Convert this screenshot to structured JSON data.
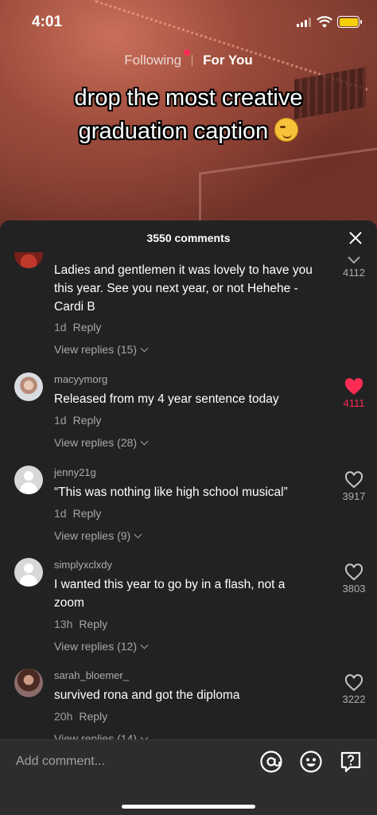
{
  "status_bar": {
    "time": "4:01"
  },
  "feed_tabs": {
    "following": "Following",
    "for_you": "For You"
  },
  "video": {
    "caption_line1": "drop the most creative",
    "caption_line2": "graduation caption"
  },
  "comments_panel": {
    "title": "3550 comments",
    "comments": [
      {
        "username": "",
        "text": "Ladies and gentlemen it was lovely to have you this year. See you next year, or not Hehehe -Cardi B",
        "time": "1d",
        "reply_label": "Reply",
        "view_replies": "View replies (15)",
        "likes": "4112",
        "liked": false
      },
      {
        "username": "macyymorg",
        "text": "Released from my 4 year sentence today",
        "time": "1d",
        "reply_label": "Reply",
        "view_replies": "View replies (28)",
        "likes": "4111",
        "liked": true
      },
      {
        "username": "jenny21g",
        "text": "“This was nothing like high school musical”",
        "time": "1d",
        "reply_label": "Reply",
        "view_replies": "View replies (9)",
        "likes": "3917",
        "liked": false
      },
      {
        "username": "simplyxclxdy",
        "text": "I wanted this year to go by in a flash, not a zoom",
        "time": "13h",
        "reply_label": "Reply",
        "view_replies": "View replies (12)",
        "likes": "3803",
        "liked": false
      },
      {
        "username": "sarah_bloemer_",
        "text": "survived rona and got the diploma",
        "time": "20h",
        "reply_label": "Reply",
        "view_replies": "View replies (14)",
        "likes": "3222",
        "liked": false
      }
    ]
  },
  "input_bar": {
    "placeholder": "Add comment..."
  },
  "colors": {
    "panel_bg": "#222222",
    "like_red": "#fe2c55",
    "battery": "#f6cf0b"
  }
}
